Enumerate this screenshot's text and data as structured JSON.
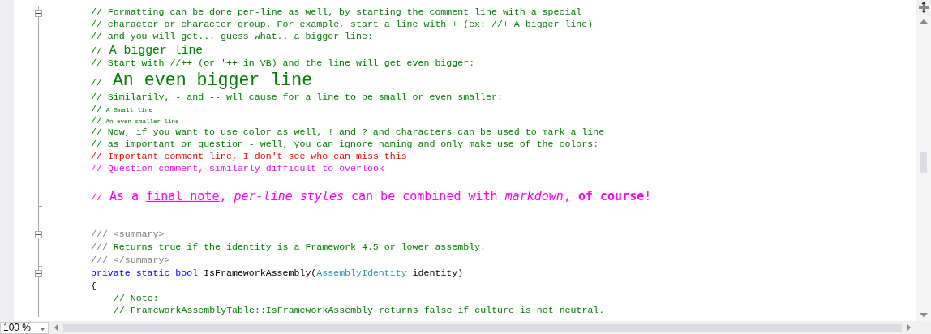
{
  "editor": {
    "lines": [
      {
        "kind": "comment",
        "collapsible": true,
        "segments": [
          {
            "kind": "text",
            "text": "// Formatting can be done per-line as well, by starting the comment line with a special"
          }
        ]
      },
      {
        "kind": "comment",
        "segments": [
          {
            "kind": "text",
            "text": "// character or character group. For example, start a line with + (ex: //+ A bigger line)"
          }
        ]
      },
      {
        "kind": "comment",
        "segments": [
          {
            "kind": "text",
            "text": "// and you will get... guess what.. a bigger line:"
          }
        ]
      },
      {
        "kind": "big",
        "segments": [
          {
            "kind": "prefix",
            "text": "//"
          },
          {
            "kind": "text",
            "text": " A bigger line"
          }
        ]
      },
      {
        "kind": "comment",
        "segments": [
          {
            "kind": "text",
            "text": "// Start with //++ (or '++ in VB) and the line will get even bigger:"
          }
        ]
      },
      {
        "kind": "bigger",
        "segments": [
          {
            "kind": "prefix",
            "text": "//"
          },
          {
            "kind": "text",
            "text": " An even bigger line"
          }
        ]
      },
      {
        "kind": "comment",
        "segments": [
          {
            "kind": "text",
            "text": "// Similarily, - and -- wll cause for a line to be small or even smaller:"
          }
        ]
      },
      {
        "kind": "small",
        "segments": [
          {
            "kind": "prefix",
            "text": "//"
          },
          {
            "kind": "text",
            "text": " A Small line"
          }
        ]
      },
      {
        "kind": "smaller",
        "segments": [
          {
            "kind": "prefix",
            "text": "//"
          },
          {
            "kind": "text",
            "text": " An even smaller line"
          }
        ]
      },
      {
        "kind": "comment",
        "segments": [
          {
            "kind": "text",
            "text": "// Now, if you want to use color as well, ! and ? and characters can be used to mark a line"
          }
        ]
      },
      {
        "kind": "comment",
        "segments": [
          {
            "kind": "text",
            "text": "// as important or question - well, you can ignore naming and only make use of the colors:"
          }
        ]
      },
      {
        "kind": "important",
        "segments": [
          {
            "kind": "prefix",
            "text": "//"
          },
          {
            "kind": "text",
            "text": " Important comment line, I don't see who can miss this"
          }
        ]
      },
      {
        "kind": "question",
        "segments": [
          {
            "kind": "prefix",
            "text": "//"
          },
          {
            "kind": "text",
            "text": " Question comment, similarly difficult to overlook"
          }
        ]
      },
      {
        "kind": "blank"
      },
      {
        "kind": "final",
        "fold_end": true,
        "segments": [
          {
            "kind": "prefix",
            "text": "//"
          },
          {
            "kind": "text",
            "text": " As a "
          },
          {
            "kind": "underline",
            "text": "final note"
          },
          {
            "kind": "text",
            "text": ", "
          },
          {
            "kind": "italic",
            "text": "per-line styles"
          },
          {
            "kind": "text",
            "text": " can be combined with "
          },
          {
            "kind": "italic",
            "text": "markdown"
          },
          {
            "kind": "text",
            "text": ", "
          },
          {
            "kind": "bold",
            "text": "of course"
          },
          {
            "kind": "text",
            "text": "!"
          }
        ]
      },
      {
        "kind": "blank"
      },
      {
        "kind": "blank"
      },
      {
        "kind": "doc",
        "collapsible": true,
        "segments": [
          {
            "kind": "doc-tag",
            "text": "/// <summary>"
          }
        ]
      },
      {
        "kind": "doc",
        "segments": [
          {
            "kind": "doc-tag",
            "text": "///"
          },
          {
            "kind": "text",
            "text": " Returns true if the identity is a Framework 4.5 or lower assembly."
          }
        ]
      },
      {
        "kind": "doc",
        "fold_end": true,
        "segments": [
          {
            "kind": "doc-tag",
            "text": "/// </summary>"
          }
        ]
      },
      {
        "kind": "code",
        "collapsible": true,
        "segments": [
          {
            "kind": "keyword",
            "text": "private static bool"
          },
          {
            "kind": "text",
            "text": " IsFrameworkAssembly("
          },
          {
            "kind": "type",
            "text": "AssemblyIdentity"
          },
          {
            "kind": "text",
            "text": " identity)"
          }
        ]
      },
      {
        "kind": "code",
        "segments": [
          {
            "kind": "text",
            "text": "{"
          }
        ],
        "children": [
          {
            "kind": "comment",
            "segments": [
              {
                "kind": "text",
                "text": "// Note:"
              }
            ]
          },
          {
            "kind": "comment",
            "segments": [
              {
                "kind": "text",
                "text": "// FrameworkAssemblyTable::IsFrameworkAssembly returns false if culture is not neutral."
              }
            ]
          }
        ]
      }
    ]
  },
  "status_bar": {
    "zoom": "100 %"
  }
}
